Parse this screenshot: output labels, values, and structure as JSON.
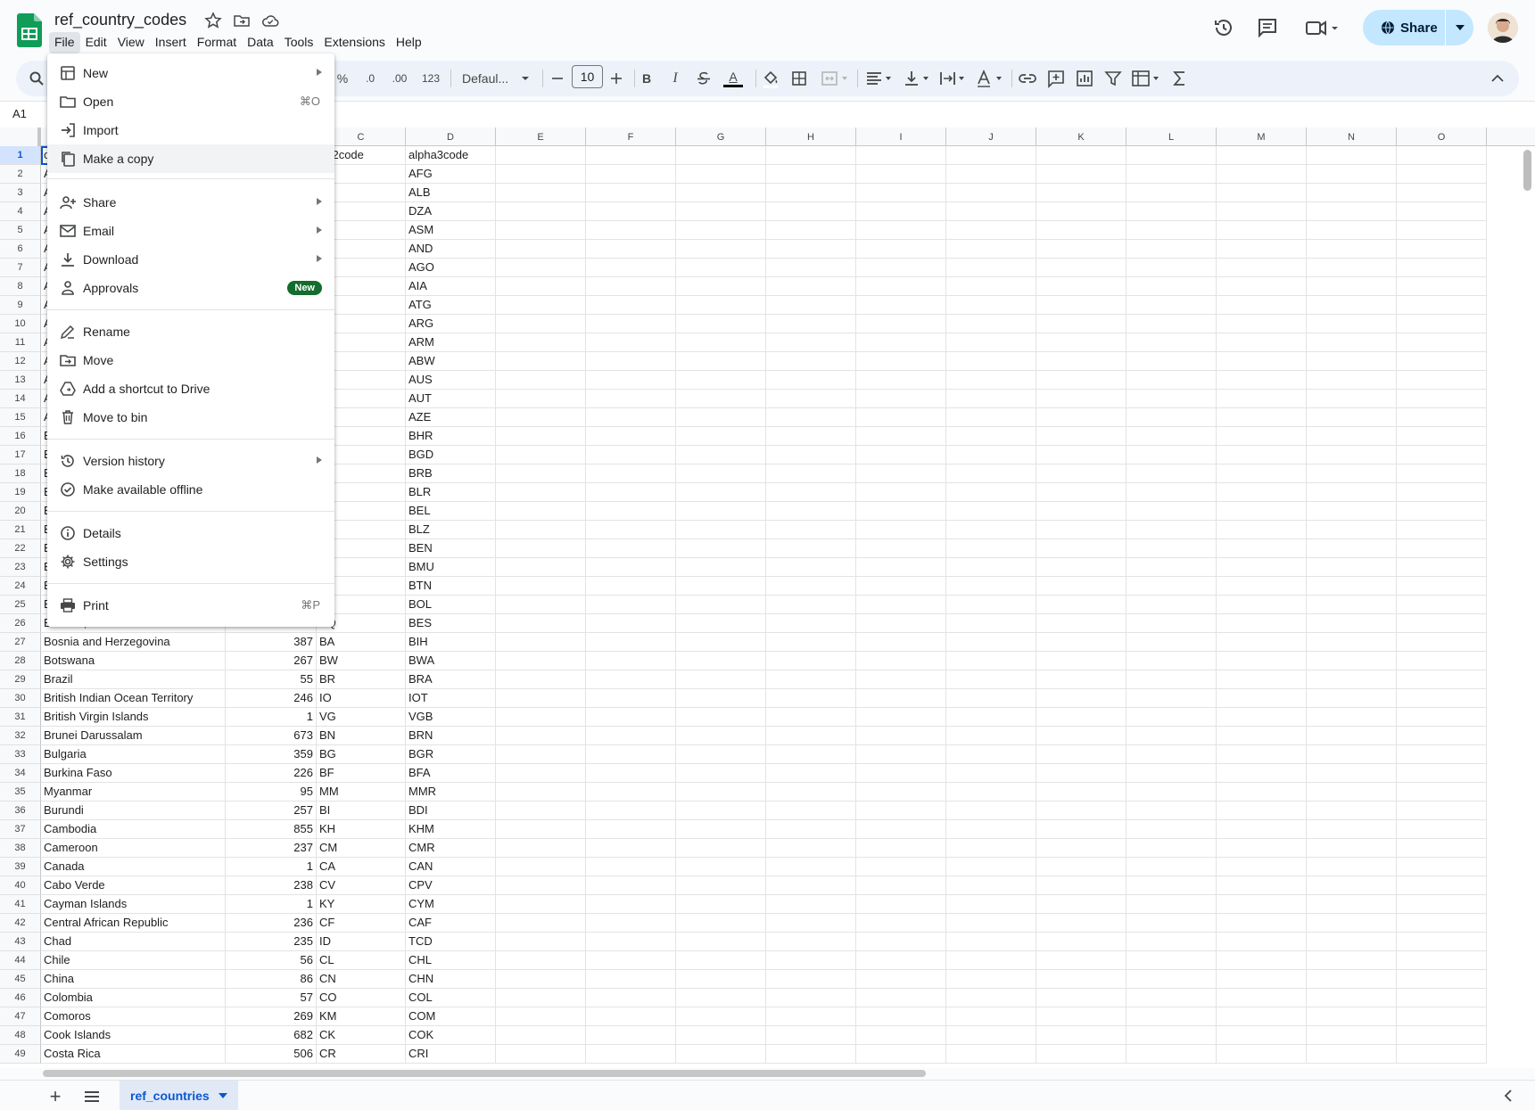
{
  "doc": {
    "title": "ref_country_codes"
  },
  "menubar": [
    "File",
    "Edit",
    "View",
    "Insert",
    "Format",
    "Data",
    "Tools",
    "Extensions",
    "Help"
  ],
  "share": {
    "label": "Share"
  },
  "toolbar": {
    "percent": "%",
    "dec_decrease": ".0",
    "dec_increase": ".00",
    "number_format": "123",
    "font": "Defaul...",
    "font_size": "10",
    "bold": "B",
    "italic": "I",
    "text_color_glyph": "A"
  },
  "name_box": "A1",
  "columns": [
    "C",
    "D",
    "E",
    "F",
    "G",
    "H",
    "I",
    "J",
    "K",
    "L",
    "M",
    "N",
    "O"
  ],
  "rows": [
    {
      "n": "1",
      "a": "c",
      "b": "",
      "c": "ha2code",
      "d": "alpha3code"
    },
    {
      "n": "2",
      "a": "A",
      "b": "",
      "c": "",
      "d": "AFG"
    },
    {
      "n": "3",
      "a": "A",
      "b": "",
      "c": "",
      "d": "ALB"
    },
    {
      "n": "4",
      "a": "A",
      "b": "",
      "c": "",
      "d": "DZA"
    },
    {
      "n": "5",
      "a": "A",
      "b": "",
      "c": "",
      "d": "ASM"
    },
    {
      "n": "6",
      "a": "A",
      "b": "",
      "c": "",
      "d": "AND"
    },
    {
      "n": "7",
      "a": "A",
      "b": "",
      "c": "",
      "d": "AGO"
    },
    {
      "n": "8",
      "a": "A",
      "b": "",
      "c": "",
      "d": "AIA"
    },
    {
      "n": "9",
      "a": "A",
      "b": "",
      "c": "",
      "d": "ATG"
    },
    {
      "n": "10",
      "a": "A",
      "b": "",
      "c": "",
      "d": "ARG"
    },
    {
      "n": "11",
      "a": "A",
      "b": "",
      "c": "",
      "d": "ARM"
    },
    {
      "n": "12",
      "a": "A",
      "b": "",
      "c": "",
      "d": "ABW"
    },
    {
      "n": "13",
      "a": "A",
      "b": "",
      "c": "",
      "d": "AUS"
    },
    {
      "n": "14",
      "a": "A",
      "b": "",
      "c": "",
      "d": "AUT"
    },
    {
      "n": "15",
      "a": "A",
      "b": "",
      "c": "",
      "d": "AZE"
    },
    {
      "n": "16",
      "a": "B",
      "b": "",
      "c": "",
      "d": "BHR"
    },
    {
      "n": "17",
      "a": "B",
      "b": "",
      "c": "",
      "d": "BGD"
    },
    {
      "n": "18",
      "a": "B",
      "b": "",
      "c": "",
      "d": "BRB"
    },
    {
      "n": "19",
      "a": "B",
      "b": "",
      "c": "",
      "d": "BLR"
    },
    {
      "n": "20",
      "a": "B",
      "b": "",
      "c": "",
      "d": "BEL"
    },
    {
      "n": "21",
      "a": "B",
      "b": "",
      "c": "",
      "d": "BLZ"
    },
    {
      "n": "22",
      "a": "B",
      "b": "",
      "c": "",
      "d": "BEN"
    },
    {
      "n": "23",
      "a": "B",
      "b": "",
      "c": "",
      "d": "BMU"
    },
    {
      "n": "24",
      "a": "B",
      "b": "",
      "c": "",
      "d": "BTN"
    },
    {
      "n": "25",
      "a": "B",
      "b": "",
      "c": "",
      "d": "BOL"
    },
    {
      "n": "26",
      "a": "Bonaire, Sint Eustatius and Saba",
      "b": "599",
      "c": "BQ",
      "d": "BES"
    },
    {
      "n": "27",
      "a": "Bosnia and Herzegovina",
      "b": "387",
      "c": "BA",
      "d": "BIH"
    },
    {
      "n": "28",
      "a": "Botswana",
      "b": "267",
      "c": "BW",
      "d": "BWA"
    },
    {
      "n": "29",
      "a": "Brazil",
      "b": "55",
      "c": "BR",
      "d": "BRA"
    },
    {
      "n": "30",
      "a": "British Indian Ocean Territory",
      "b": "246",
      "c": "IO",
      "d": "IOT"
    },
    {
      "n": "31",
      "a": "British Virgin Islands",
      "b": "1",
      "c": "VG",
      "d": "VGB"
    },
    {
      "n": "32",
      "a": "Brunei Darussalam",
      "b": "673",
      "c": "BN",
      "d": "BRN"
    },
    {
      "n": "33",
      "a": "Bulgaria",
      "b": "359",
      "c": "BG",
      "d": "BGR"
    },
    {
      "n": "34",
      "a": "Burkina Faso",
      "b": "226",
      "c": "BF",
      "d": "BFA"
    },
    {
      "n": "35",
      "a": "Myanmar",
      "b": "95",
      "c": "MM",
      "d": "MMR"
    },
    {
      "n": "36",
      "a": "Burundi",
      "b": "257",
      "c": "BI",
      "d": "BDI"
    },
    {
      "n": "37",
      "a": "Cambodia",
      "b": "855",
      "c": "KH",
      "d": "KHM"
    },
    {
      "n": "38",
      "a": "Cameroon",
      "b": "237",
      "c": "CM",
      "d": "CMR"
    },
    {
      "n": "39",
      "a": "Canada",
      "b": "1",
      "c": "CA",
      "d": "CAN"
    },
    {
      "n": "40",
      "a": "Cabo Verde",
      "b": "238",
      "c": "CV",
      "d": "CPV"
    },
    {
      "n": "41",
      "a": "Cayman Islands",
      "b": "1",
      "c": "KY",
      "d": "CYM"
    },
    {
      "n": "42",
      "a": "Central African Republic",
      "b": "236",
      "c": "CF",
      "d": "CAF"
    },
    {
      "n": "43",
      "a": "Chad",
      "b": "235",
      "c": "ID",
      "d": "TCD"
    },
    {
      "n": "44",
      "a": "Chile",
      "b": "56",
      "c": "CL",
      "d": "CHL"
    },
    {
      "n": "45",
      "a": "China",
      "b": "86",
      "c": "CN",
      "d": "CHN"
    },
    {
      "n": "46",
      "a": "Colombia",
      "b": "57",
      "c": "CO",
      "d": "COL"
    },
    {
      "n": "47",
      "a": "Comoros",
      "b": "269",
      "c": "KM",
      "d": "COM"
    },
    {
      "n": "48",
      "a": "Cook Islands",
      "b": "682",
      "c": "CK",
      "d": "COK"
    },
    {
      "n": "49",
      "a": "Costa Rica",
      "b": "506",
      "c": "CR",
      "d": "CRI"
    }
  ],
  "file_menu": {
    "new": "New",
    "open": "Open",
    "open_shortcut": "⌘O",
    "import": "Import",
    "make_copy": "Make a copy",
    "share": "Share",
    "email": "Email",
    "download": "Download",
    "approvals": "Approvals",
    "approvals_badge": "New",
    "rename": "Rename",
    "move": "Move",
    "add_shortcut": "Add a shortcut to Drive",
    "move_to_bin": "Move to bin",
    "version_history": "Version history",
    "make_offline": "Make available offline",
    "details": "Details",
    "settings": "Settings",
    "print": "Print",
    "print_shortcut": "⌘P"
  },
  "sheet_tab": {
    "name": "ref_countries"
  },
  "colors": {
    "accent": "#0b57d0",
    "share_bg": "#c2e7ff",
    "sheets_green": "#0f9d58",
    "badge_green": "#146c2e"
  }
}
